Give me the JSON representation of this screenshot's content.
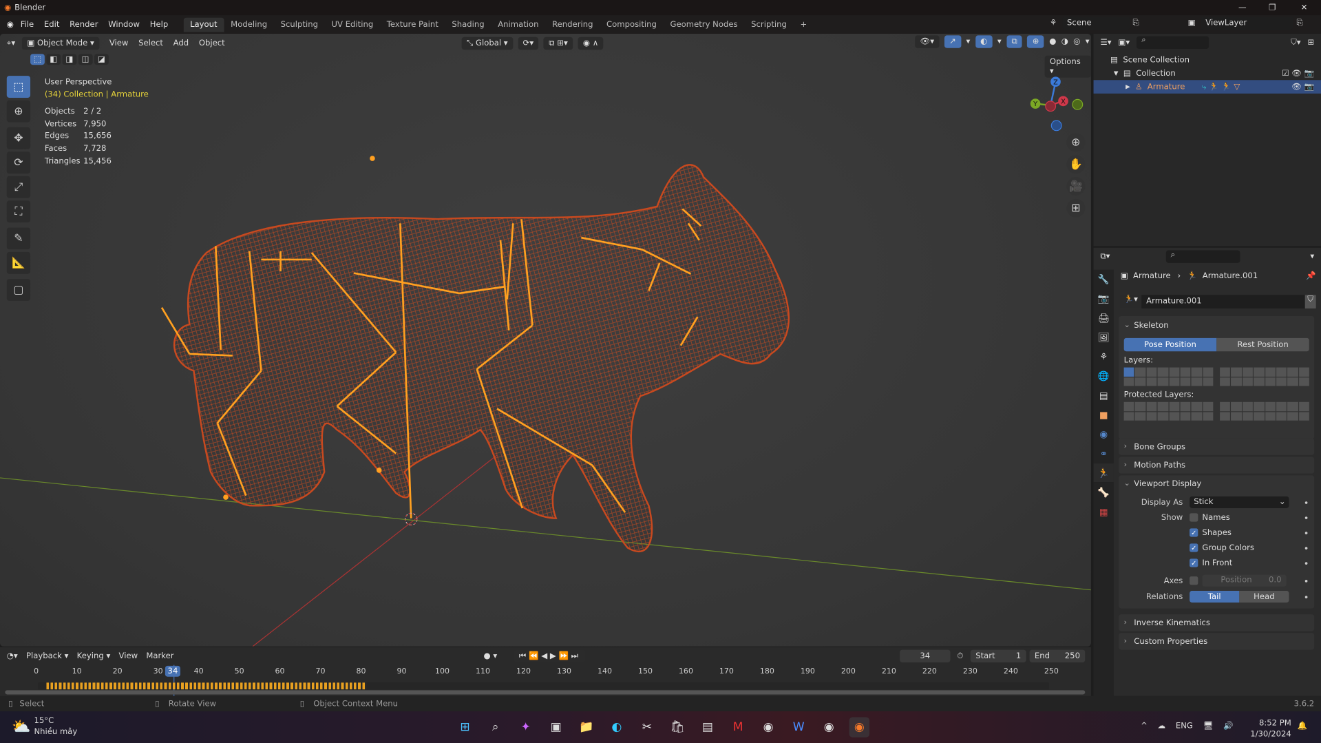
{
  "app": {
    "title": "Blender",
    "version": "3.6.2"
  },
  "menu": [
    "File",
    "Edit",
    "Render",
    "Window",
    "Help"
  ],
  "workspaces": [
    "Layout",
    "Modeling",
    "Sculpting",
    "UV Editing",
    "Texture Paint",
    "Shading",
    "Animation",
    "Rendering",
    "Compositing",
    "Geometry Nodes",
    "Scripting"
  ],
  "workspace_add": "+",
  "scene": {
    "name": "Scene",
    "view_layer": "ViewLayer"
  },
  "viewport": {
    "mode": "Object Mode",
    "menus": [
      "View",
      "Select",
      "Add",
      "Object"
    ],
    "orientation": "Global",
    "options": "Options",
    "perspective": "User Perspective",
    "context": "(34) Collection | Armature",
    "stats": [
      {
        "k": "Objects",
        "v": "2 / 2"
      },
      {
        "k": "Vertices",
        "v": "7,950"
      },
      {
        "k": "Edges",
        "v": "15,656"
      },
      {
        "k": "Faces",
        "v": "7,728"
      },
      {
        "k": "Triangles",
        "v": "15,456"
      }
    ],
    "gizmo": {
      "x": "X",
      "y": "Y",
      "z": "Z"
    }
  },
  "outliner": {
    "root": "Scene Collection",
    "collection": "Collection",
    "object": "Armature"
  },
  "properties": {
    "breadcrumb_object": "Armature",
    "breadcrumb_data": "Armature.001",
    "data_name": "Armature.001",
    "skeleton": {
      "title": "Skeleton",
      "pose": "Pose Position",
      "rest": "Rest Position",
      "layers": "Layers:",
      "protected": "Protected Layers:"
    },
    "bone_groups": "Bone Groups",
    "motion_paths": "Motion Paths",
    "viewport_display": {
      "title": "Viewport Display",
      "display_as_label": "Display As",
      "display_as": "Stick",
      "show_label": "Show",
      "names": "Names",
      "shapes": "Shapes",
      "group_colors": "Group Colors",
      "in_front": "In Front",
      "names_checked": false,
      "shapes_checked": true,
      "group_colors_checked": true,
      "in_front_checked": true,
      "axes_label": "Axes",
      "axes_position": "Position",
      "axes_value": "0.0",
      "relations_label": "Relations",
      "tail": "Tail",
      "head": "Head"
    },
    "inverse_kinematics": "Inverse Kinematics",
    "custom_properties": "Custom Properties"
  },
  "timeline": {
    "menus": [
      "Playback",
      "Keying",
      "View",
      "Marker"
    ],
    "current": "34",
    "start_label": "Start",
    "start": "1",
    "end_label": "End",
    "end": "250",
    "ticks": [
      "0",
      "10",
      "20",
      "30",
      "40",
      "50",
      "60",
      "70",
      "80",
      "90",
      "100",
      "110",
      "120",
      "130",
      "140",
      "150",
      "160",
      "170",
      "180",
      "190",
      "200",
      "210",
      "220",
      "230",
      "240",
      "250"
    ]
  },
  "status": {
    "select": "Select",
    "rotate": "Rotate View",
    "context": "Object Context Menu"
  },
  "taskbar": {
    "temp": "15°C",
    "weather": "Nhiều mây",
    "lang": "ENG",
    "time": "8:52 PM",
    "date": "1/30/2024"
  },
  "colors": {
    "accent": "#4772b3",
    "wire": "#c8491f",
    "bone": "#ffa020",
    "context": "#e5d23a"
  }
}
